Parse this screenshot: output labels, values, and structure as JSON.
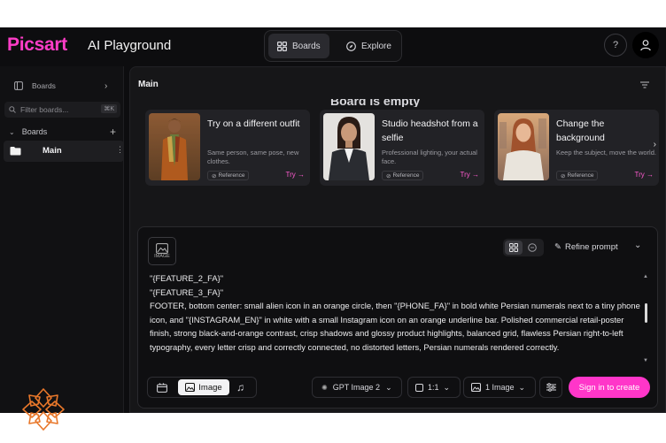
{
  "header": {
    "logo": "Picsart",
    "product": "AI Playground",
    "tabs": [
      {
        "label": "Boards",
        "icon": "grid-icon",
        "active": true
      },
      {
        "label": "Explore",
        "icon": "compass-icon",
        "active": false
      }
    ],
    "help_icon": "question-icon",
    "user_icon": "user-icon"
  },
  "sidebar": {
    "boards_header": "Boards",
    "filter_placeholder": "Filter boards...",
    "filter_shortcut": "⌘K",
    "section_label": "Boards",
    "items": [
      {
        "label": "Main",
        "icon": "folder-icon"
      }
    ]
  },
  "main": {
    "title": "Main",
    "empty_title": "Board is empty",
    "cards": [
      {
        "title": "Try on a different outfit",
        "desc": "Same person, same pose, new clothes.",
        "ref": "Reference",
        "try": "Try →"
      },
      {
        "title": "Studio headshot from a selfie",
        "desc": "Professional lighting, your actual face.",
        "ref": "Reference",
        "try": "Try →"
      },
      {
        "title": "Change the background",
        "desc": "Keep the subject, move the world.",
        "ref": "Reference",
        "try": "Try →"
      }
    ]
  },
  "prompt": {
    "chip_label": "IMAGE",
    "refine_label": "Refine prompt",
    "lines": [
      "\"{FEATURE_2_FA}\"",
      "\"{FEATURE_3_FA}\"",
      "FOOTER, bottom center: small alien icon in an orange circle, then \"{PHONE_FA}\" in bold white Persian numerals next to a tiny phone icon, and \"{INSTAGRAM_EN}\" in white with a small Instagram icon on an orange underline bar. Polished commercial retail-poster finish, strong black-and-orange contrast, crisp shadows and glossy product highlights, balanced grid, flawless Persian right-to-left typography, every letter crisp and correctly connected, no distorted letters, Persian numerals rendered correctly."
    ]
  },
  "toolbar": {
    "mode_image": "Image",
    "model": "GPT Image 2",
    "ratio": "1:1",
    "count": "1 Image",
    "signin": "Sign in to create"
  },
  "colors": {
    "accent": "#ff36c9",
    "background": "#0d0d0f",
    "panel": "#161618",
    "ornament": "#e8772a"
  }
}
